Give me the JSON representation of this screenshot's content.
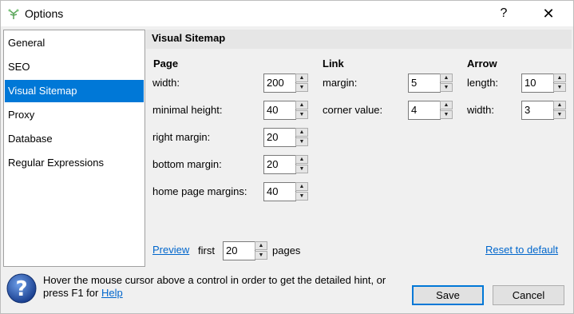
{
  "window": {
    "title": "Options",
    "help_glyph": "?",
    "close_glyph": "✕"
  },
  "nav": {
    "items": [
      {
        "label": "General"
      },
      {
        "label": "SEO"
      },
      {
        "label": "Visual Sitemap",
        "selected": true
      },
      {
        "label": "Proxy"
      },
      {
        "label": "Database"
      },
      {
        "label": "Regular Expressions"
      }
    ]
  },
  "panel": {
    "title": "Visual Sitemap",
    "page": {
      "heading": "Page",
      "width_label": "width:",
      "width_value": "200",
      "min_height_label": "minimal height:",
      "min_height_value": "40",
      "right_margin_label": "right margin:",
      "right_margin_value": "20",
      "bottom_margin_label": "bottom margin:",
      "bottom_margin_value": "20",
      "home_margins_label": "home page margins:",
      "home_margins_value": "40"
    },
    "link": {
      "heading": "Link",
      "margin_label": "margin:",
      "margin_value": "5",
      "corner_label": "corner value:",
      "corner_value": "4"
    },
    "arrow": {
      "heading": "Arrow",
      "length_label": "length:",
      "length_value": "10",
      "width_label": "width:",
      "width_value": "3"
    },
    "preview": {
      "link_label": "Preview",
      "first_label": "first",
      "pages_value": "20",
      "pages_label": "pages"
    },
    "reset_label": "Reset to default"
  },
  "footer": {
    "hint_text": "Hover the mouse cursor above a control in order to get the detailed hint, or press F1 for ",
    "help_link": "Help",
    "save_label": "Save",
    "cancel_label": "Cancel"
  },
  "colors": {
    "accent": "#0078d7",
    "link": "#0066cc",
    "selection": "#0078d7"
  },
  "icons": {
    "app": "leaf-sprout-icon",
    "hint": "question-mark-icon"
  }
}
